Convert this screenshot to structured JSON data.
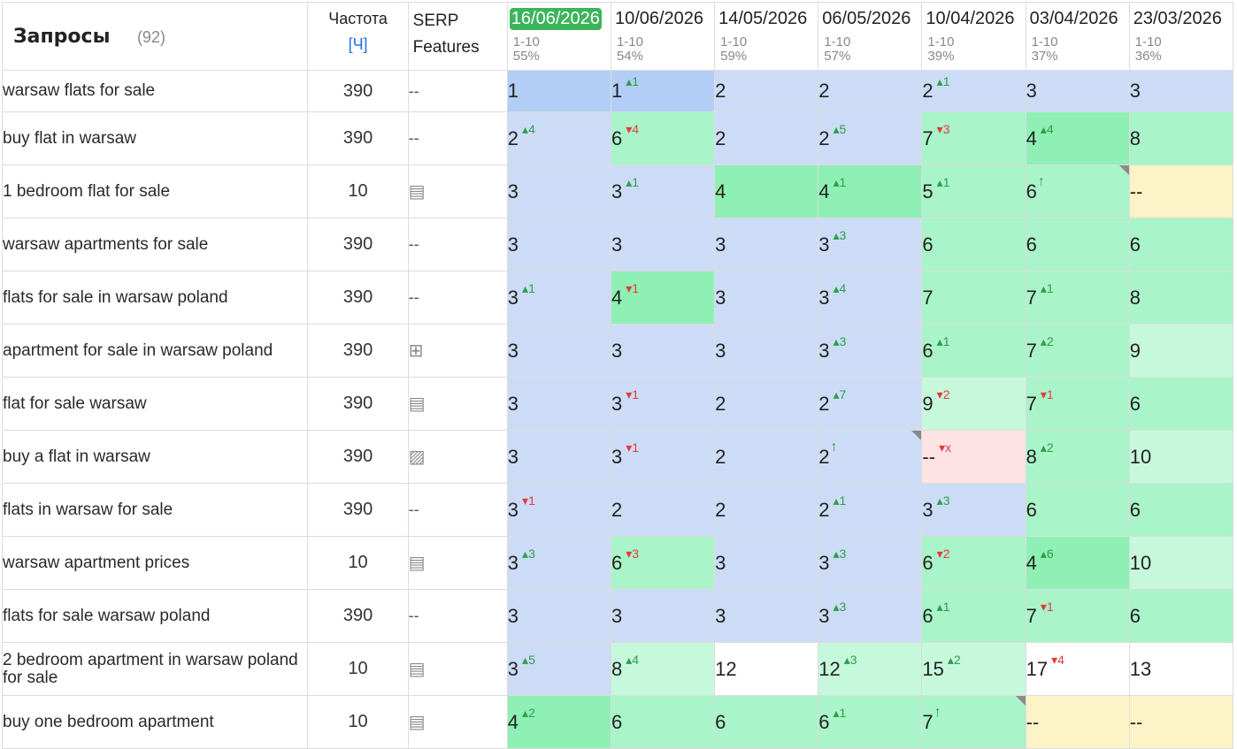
{
  "header": {
    "title": "Запросы",
    "count": "(92)",
    "freq_label": "Частота",
    "freq_link": "[Ч]",
    "serp_label_1": "SERP",
    "serp_label_2": "Features",
    "dates": [
      {
        "date": "16/06/2026",
        "range": "1-10",
        "pct": "55%",
        "active": true
      },
      {
        "date": "10/06/2026",
        "range": "1-10",
        "pct": "54%"
      },
      {
        "date": "14/05/2026",
        "range": "1-10",
        "pct": "59%"
      },
      {
        "date": "06/05/2026",
        "range": "1-10",
        "pct": "57%"
      },
      {
        "date": "10/04/2026",
        "range": "1-10",
        "pct": "39%"
      },
      {
        "date": "03/04/2026",
        "range": "1-10",
        "pct": "37%"
      },
      {
        "date": "23/03/2026",
        "range": "1-10",
        "pct": "36%"
      }
    ]
  },
  "colors": {
    "blue": "#ccdcf7",
    "blue2": "#b3cef6",
    "g1": "#c6f9dc",
    "g2": "#a9f4c9",
    "g3": "#8ef0b4",
    "yel": "#fcf3c6",
    "red": "#fde3e3",
    "wht": "#ffffff",
    "accent": "#3cb55a",
    "link": "#1a73e8"
  },
  "rows": [
    {
      "query": "warsaw flats for sale",
      "freq": "390",
      "serp": "--",
      "cells": [
        {
          "v": "1",
          "c": "blue2"
        },
        {
          "v": "1",
          "ch": "1",
          "d": "up",
          "c": "blue2"
        },
        {
          "v": "2",
          "c": "blue"
        },
        {
          "v": "2",
          "c": "blue"
        },
        {
          "v": "2",
          "ch": "1",
          "d": "up",
          "c": "blue"
        },
        {
          "v": "3",
          "c": "blue"
        },
        {
          "v": "3",
          "c": "blue"
        }
      ]
    },
    {
      "query": "buy flat in warsaw",
      "freq": "390",
      "serp": "--",
      "cells": [
        {
          "v": "2",
          "ch": "4",
          "d": "up",
          "c": "blue"
        },
        {
          "v": "6",
          "ch": "4",
          "d": "down",
          "c": "g2"
        },
        {
          "v": "2",
          "c": "blue"
        },
        {
          "v": "2",
          "ch": "5",
          "d": "up",
          "c": "blue"
        },
        {
          "v": "7",
          "ch": "3",
          "d": "down",
          "c": "g2"
        },
        {
          "v": "4",
          "ch": "4",
          "d": "up",
          "c": "g3"
        },
        {
          "v": "8",
          "c": "g2"
        }
      ]
    },
    {
      "query": "1 bedroom flat for sale",
      "freq": "10",
      "serp_icon": "news-icon",
      "serp_glyph": "▤",
      "cells": [
        {
          "v": "3",
          "c": "blue"
        },
        {
          "v": "3",
          "ch": "1",
          "d": "up",
          "c": "blue"
        },
        {
          "v": "4",
          "c": "g3"
        },
        {
          "v": "4",
          "ch": "1",
          "d": "up",
          "c": "g3"
        },
        {
          "v": "5",
          "ch": "1",
          "d": "up",
          "c": "g2"
        },
        {
          "v": "6",
          "ch": "↑",
          "d": "arrow",
          "c": "g2",
          "corner": true
        },
        {
          "v": "--",
          "c": "yel"
        }
      ]
    },
    {
      "query": "warsaw apartments for sale",
      "freq": "390",
      "serp": "--",
      "cells": [
        {
          "v": "3",
          "c": "blue"
        },
        {
          "v": "3",
          "c": "blue"
        },
        {
          "v": "3",
          "c": "blue"
        },
        {
          "v": "3",
          "ch": "3",
          "d": "up",
          "c": "blue"
        },
        {
          "v": "6",
          "c": "g2"
        },
        {
          "v": "6",
          "c": "g2"
        },
        {
          "v": "6",
          "c": "g2"
        }
      ]
    },
    {
      "query": "flats for sale in warsaw poland",
      "freq": "390",
      "serp": "--",
      "cells": [
        {
          "v": "3",
          "ch": "1",
          "d": "up",
          "c": "blue"
        },
        {
          "v": "4",
          "ch": "1",
          "d": "down",
          "c": "g3"
        },
        {
          "v": "3",
          "c": "blue"
        },
        {
          "v": "3",
          "ch": "4",
          "d": "up",
          "c": "blue"
        },
        {
          "v": "7",
          "c": "g2"
        },
        {
          "v": "7",
          "ch": "1",
          "d": "up",
          "c": "g2"
        },
        {
          "v": "8",
          "c": "g2"
        }
      ]
    },
    {
      "query": "apartment for sale in warsaw poland",
      "freq": "390",
      "serp_icon": "map-icon",
      "serp_glyph": "⊞",
      "cells": [
        {
          "v": "3",
          "c": "blue"
        },
        {
          "v": "3",
          "c": "blue"
        },
        {
          "v": "3",
          "c": "blue"
        },
        {
          "v": "3",
          "ch": "3",
          "d": "up",
          "c": "blue"
        },
        {
          "v": "6",
          "ch": "1",
          "d": "up",
          "c": "g2"
        },
        {
          "v": "7",
          "ch": "2",
          "d": "up",
          "c": "g2"
        },
        {
          "v": "9",
          "c": "g1"
        }
      ]
    },
    {
      "query": "flat for sale warsaw",
      "freq": "390",
      "serp_icon": "news-icon",
      "serp_glyph": "▤",
      "cells": [
        {
          "v": "3",
          "c": "blue"
        },
        {
          "v": "3",
          "ch": "1",
          "d": "down",
          "c": "blue"
        },
        {
          "v": "2",
          "c": "blue"
        },
        {
          "v": "2",
          "ch": "7",
          "d": "up",
          "c": "blue"
        },
        {
          "v": "9",
          "ch": "2",
          "d": "down",
          "c": "g1"
        },
        {
          "v": "7",
          "ch": "1",
          "d": "down",
          "c": "g2"
        },
        {
          "v": "6",
          "c": "g2"
        }
      ]
    },
    {
      "query": "buy a flat in warsaw",
      "freq": "390",
      "serp_icon": "image-icon",
      "serp_glyph": "▨",
      "cells": [
        {
          "v": "3",
          "c": "blue"
        },
        {
          "v": "3",
          "ch": "1",
          "d": "down",
          "c": "blue"
        },
        {
          "v": "2",
          "c": "blue"
        },
        {
          "v": "2",
          "ch": "↑",
          "d": "arrow",
          "c": "blue",
          "corner": true
        },
        {
          "v": "--",
          "ch": "x",
          "d": "down",
          "c": "red"
        },
        {
          "v": "8",
          "ch": "2",
          "d": "up",
          "c": "g2"
        },
        {
          "v": "10",
          "c": "g1"
        }
      ]
    },
    {
      "query": "flats in warsaw for sale",
      "freq": "390",
      "serp": "--",
      "cells": [
        {
          "v": "3",
          "ch": "1",
          "d": "down",
          "c": "blue"
        },
        {
          "v": "2",
          "c": "blue"
        },
        {
          "v": "2",
          "c": "blue"
        },
        {
          "v": "2",
          "ch": "1",
          "d": "up",
          "c": "blue"
        },
        {
          "v": "3",
          "ch": "3",
          "d": "up",
          "c": "blue"
        },
        {
          "v": "6",
          "c": "g2"
        },
        {
          "v": "6",
          "c": "g2"
        }
      ]
    },
    {
      "query": "warsaw apartment prices",
      "freq": "10",
      "serp_icon": "news-icon",
      "serp_glyph": "▤",
      "cells": [
        {
          "v": "3",
          "ch": "3",
          "d": "up",
          "c": "blue"
        },
        {
          "v": "6",
          "ch": "3",
          "d": "down",
          "c": "g2"
        },
        {
          "v": "3",
          "c": "blue"
        },
        {
          "v": "3",
          "ch": "3",
          "d": "up",
          "c": "blue"
        },
        {
          "v": "6",
          "ch": "2",
          "d": "down",
          "c": "g2"
        },
        {
          "v": "4",
          "ch": "6",
          "d": "up",
          "c": "g3"
        },
        {
          "v": "10",
          "c": "g1"
        }
      ]
    },
    {
      "query": "flats for sale warsaw poland",
      "freq": "390",
      "serp": "--",
      "cells": [
        {
          "v": "3",
          "c": "blue"
        },
        {
          "v": "3",
          "c": "blue"
        },
        {
          "v": "3",
          "c": "blue"
        },
        {
          "v": "3",
          "ch": "3",
          "d": "up",
          "c": "blue"
        },
        {
          "v": "6",
          "ch": "1",
          "d": "up",
          "c": "g2"
        },
        {
          "v": "7",
          "ch": "1",
          "d": "down",
          "c": "g2"
        },
        {
          "v": "6",
          "c": "g2"
        }
      ]
    },
    {
      "query": "2 bedroom apartment in warsaw poland for sale",
      "freq": "10",
      "serp_icon": "news-icon",
      "serp_glyph": "▤",
      "cells": [
        {
          "v": "3",
          "ch": "5",
          "d": "up",
          "c": "blue"
        },
        {
          "v": "8",
          "ch": "4",
          "d": "up",
          "c": "g1"
        },
        {
          "v": "12",
          "c": "wht"
        },
        {
          "v": "12",
          "ch": "3",
          "d": "up",
          "c": "g1"
        },
        {
          "v": "15",
          "ch": "2",
          "d": "up",
          "c": "g1"
        },
        {
          "v": "17",
          "ch": "4",
          "d": "down",
          "c": "wht"
        },
        {
          "v": "13",
          "c": "wht"
        }
      ]
    },
    {
      "query": "buy one bedroom apartment",
      "freq": "10",
      "serp_icon": "news-icon",
      "serp_glyph": "▤",
      "cells": [
        {
          "v": "4",
          "ch": "2",
          "d": "up",
          "c": "g3"
        },
        {
          "v": "6",
          "c": "g2"
        },
        {
          "v": "6",
          "c": "g2"
        },
        {
          "v": "6",
          "ch": "1",
          "d": "up",
          "c": "g2"
        },
        {
          "v": "7",
          "ch": "↑",
          "d": "arrow",
          "c": "g2",
          "corner": true
        },
        {
          "v": "--",
          "c": "yel"
        },
        {
          "v": "--",
          "c": "yel"
        }
      ]
    }
  ]
}
